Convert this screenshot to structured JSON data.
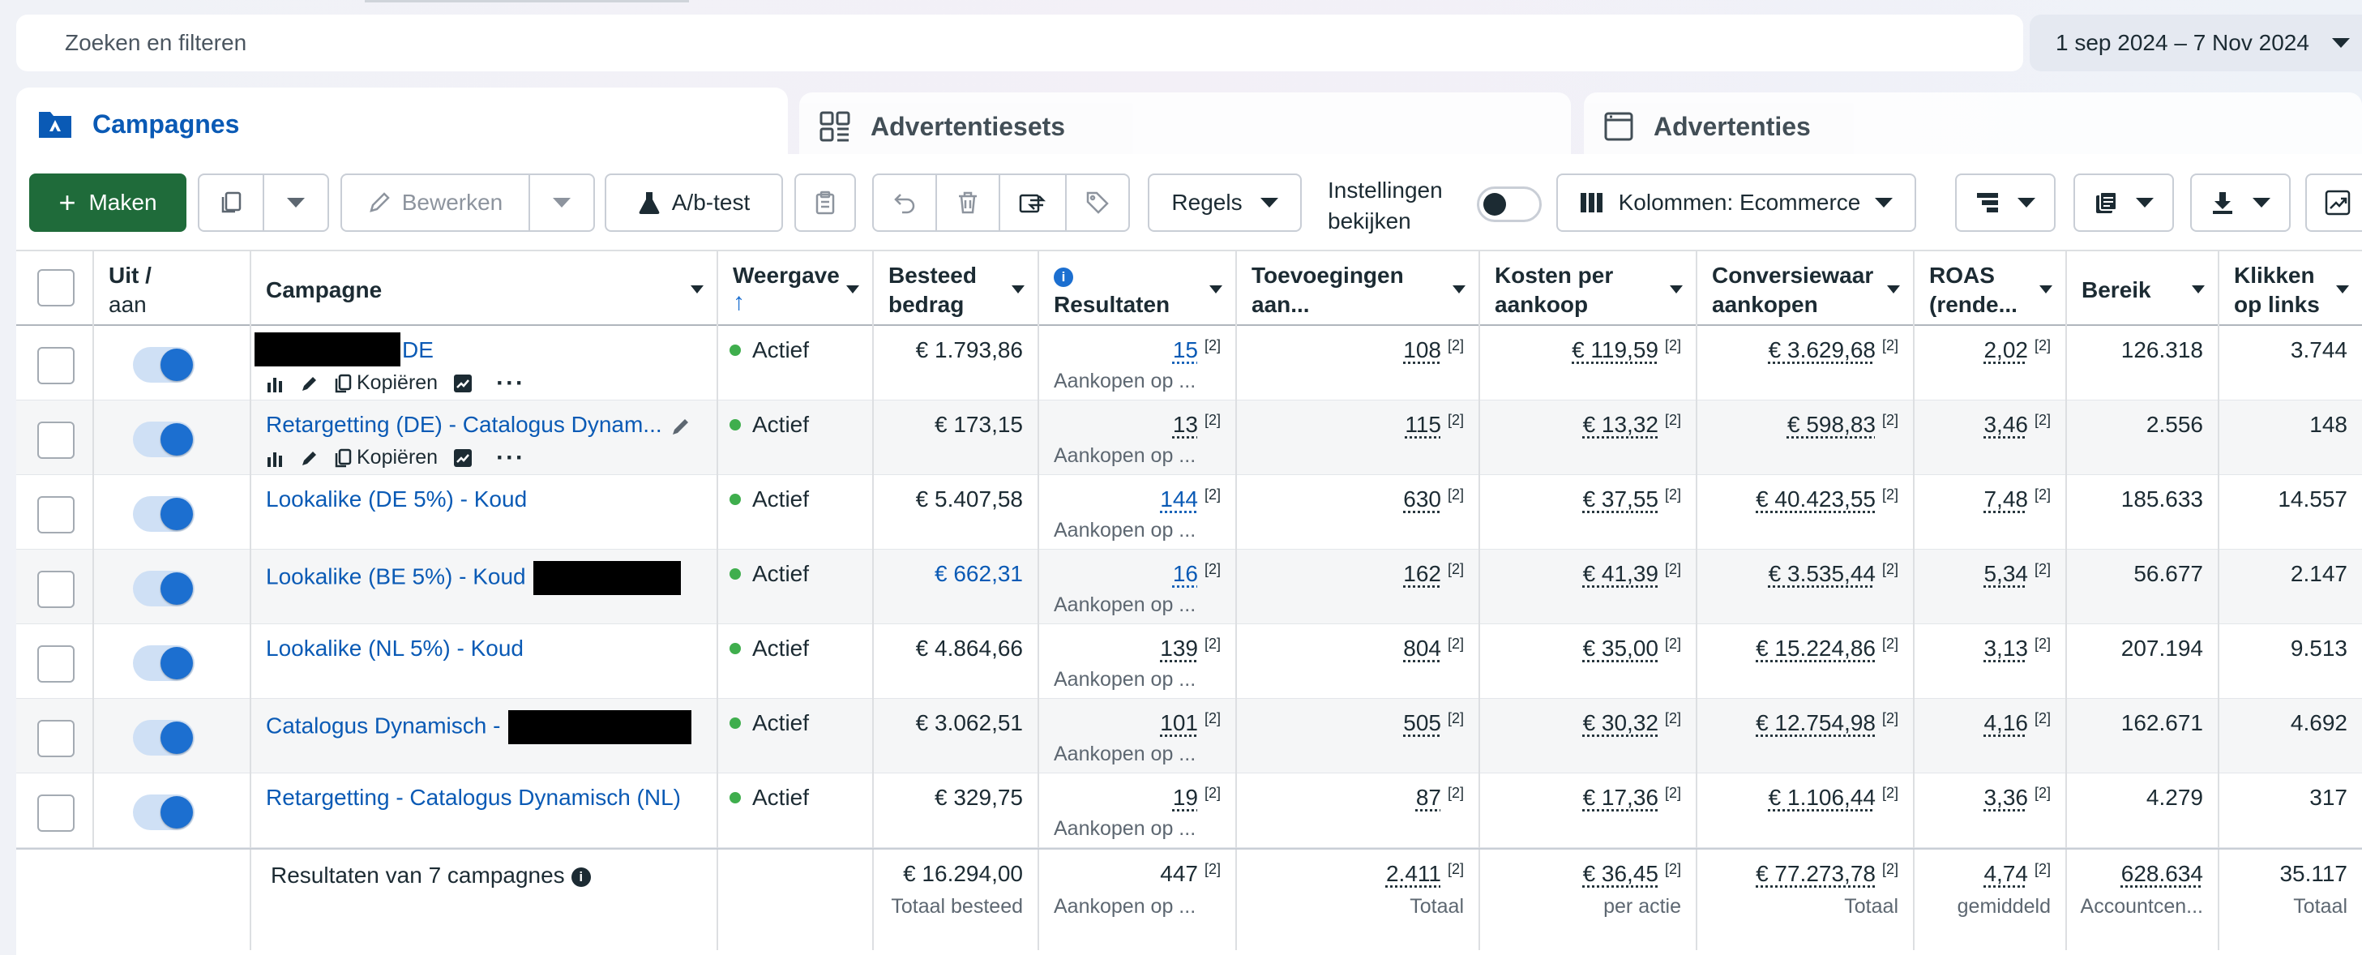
{
  "search": {
    "placeholder": "Zoeken en filteren"
  },
  "date_range": "1 sep 2024 – 7 Nov 2024",
  "tabs": [
    {
      "label": "Campagnes",
      "active": true
    },
    {
      "label": "Advertentiesets",
      "active": false
    },
    {
      "label": "Advertenties",
      "active": false
    }
  ],
  "toolbar": {
    "create": "Maken",
    "edit": "Bewerken",
    "ab_test": "A/b-test",
    "rules": "Regels",
    "settings_line1": "Instellingen",
    "settings_line2": "bekijken",
    "columns": "Kolommen: Ecommerce"
  },
  "headers": {
    "onoff": [
      "Uit /",
      "aan"
    ],
    "campaign": "Campagne",
    "delivery": "Weergave",
    "spent": [
      "Besteed",
      "bedrag"
    ],
    "results": "Resultaten",
    "adds": [
      "Toevoegingen",
      "aan..."
    ],
    "cpa": [
      "Kosten per",
      "aankoop"
    ],
    "conv_value": [
      "Conversiewaar",
      "aankopen"
    ],
    "roas": [
      "ROAS",
      "(rende..."
    ],
    "reach": "Bereik",
    "clicks": [
      "Klikken",
      "op links"
    ]
  },
  "row_actions": {
    "copy": "Kopiëren"
  },
  "rows": [
    {
      "name": "DE",
      "redact_before": true,
      "status": "Actief",
      "spent": "€ 1.793,86",
      "results": "15",
      "results_sub": "Aankopen op ...",
      "adds": "108",
      "cpa": "€ 119,59",
      "conv_value": "€ 3.629,68",
      "roas": "2,02",
      "reach": "126.318",
      "clicks": "3.744",
      "fn": "[2]"
    },
    {
      "name": "Retargetting (DE) - Catalogus Dynam...",
      "status": "Actief",
      "spent": "€ 173,15",
      "results": "13",
      "results_sub": "Aankopen op ...",
      "adds": "115",
      "cpa": "€ 13,32",
      "conv_value": "€ 598,83",
      "roas": "3,46",
      "reach": "2.556",
      "clicks": "148",
      "fn": "[2]"
    },
    {
      "name": "Lookalike (DE 5%) - Koud",
      "status": "Actief",
      "spent": "€ 5.407,58",
      "results": "144",
      "results_sub": "Aankopen op ...",
      "adds": "630",
      "cpa": "€ 37,55",
      "conv_value": "€ 40.423,55",
      "roas": "7,48",
      "reach": "185.633",
      "clicks": "14.557",
      "fn": "[2]"
    },
    {
      "name": "Lookalike (BE 5%) - Koud",
      "status": "Actief",
      "spent": "€ 662,31",
      "results": "16",
      "results_sub": "Aankopen op ...",
      "adds": "162",
      "cpa": "€ 41,39",
      "conv_value": "€ 3.535,44",
      "roas": "5,34",
      "reach": "56.677",
      "clicks": "2.147",
      "fn": "[2]"
    },
    {
      "name": "Lookalike (NL 5%) - Koud",
      "status": "Actief",
      "spent": "€ 4.864,66",
      "results": "139",
      "results_sub": "Aankopen op ...",
      "adds": "804",
      "cpa": "€ 35,00",
      "conv_value": "€ 15.224,86",
      "roas": "3,13",
      "reach": "207.194",
      "clicks": "9.513",
      "fn": "[2]"
    },
    {
      "name": "Catalogus Dynamisch -",
      "status": "Actief",
      "spent": "€ 3.062,51",
      "results": "101",
      "results_sub": "Aankopen op ...",
      "adds": "505",
      "cpa": "€ 30,32",
      "conv_value": "€ 12.754,98",
      "roas": "4,16",
      "reach": "162.671",
      "clicks": "4.692",
      "fn": "[2]"
    },
    {
      "name": "Retargetting - Catalogus Dynamisch (NL)",
      "status": "Actief",
      "spent": "€ 329,75",
      "results": "19",
      "results_sub": "Aankopen op ...",
      "adds": "87",
      "cpa": "€ 17,36",
      "conv_value": "€ 1.106,44",
      "roas": "3,36",
      "reach": "4.279",
      "clicks": "317",
      "fn": "[2]"
    }
  ],
  "totals": {
    "label": "Resultaten van 7 campagnes",
    "spent": "€ 16.294,00",
    "spent_sub": "Totaal besteed",
    "results": "447",
    "results_sub": "Aankopen op ...",
    "adds": "2.411",
    "adds_sub": "Totaal",
    "cpa": "€ 36,45",
    "cpa_sub": "per actie",
    "conv_value": "€ 77.273,78",
    "conv_value_sub": "Totaal",
    "roas": "4,74",
    "roas_sub": "gemiddeld",
    "reach": "628.634",
    "reach_sub": "Accountcen...",
    "clicks": "35.117",
    "clicks_sub": "Totaal",
    "fn": "[2]"
  }
}
